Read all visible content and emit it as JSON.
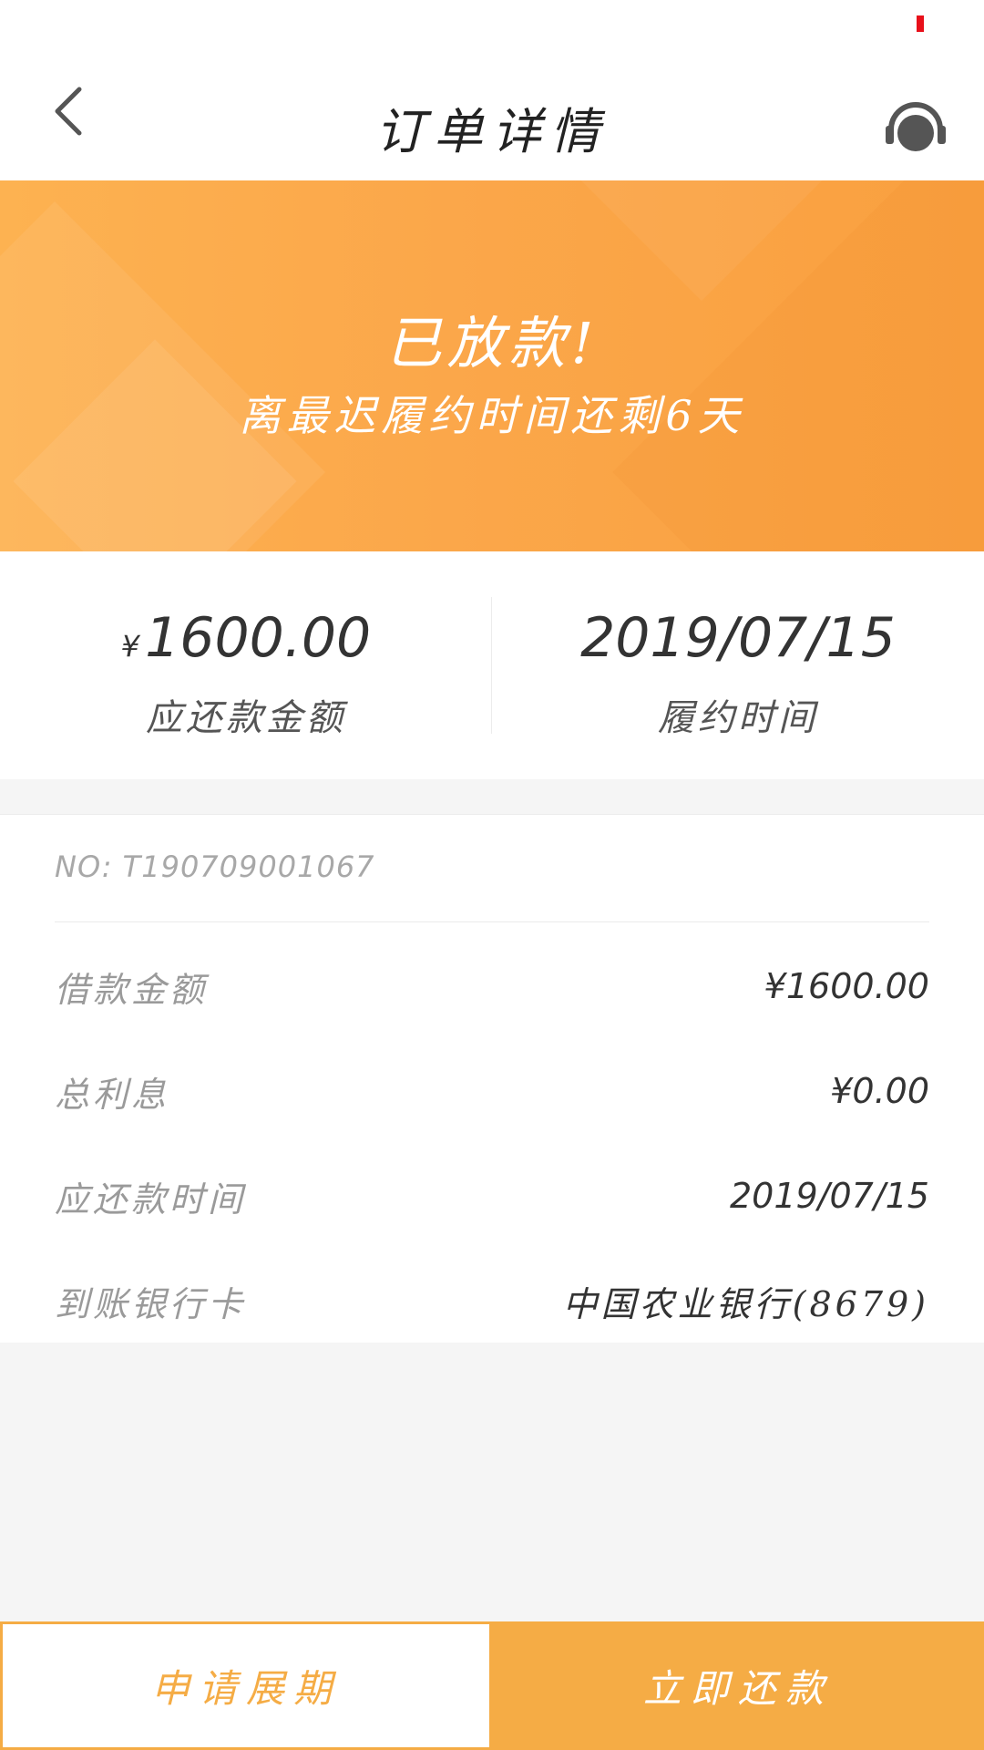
{
  "status_bar": {
    "indicator_color": "#e8101a"
  },
  "nav": {
    "title": "订单详情",
    "back_icon": "chevron-left-icon",
    "service_icon": "headset-icon"
  },
  "banner": {
    "title": "已放款!",
    "subtitle": "离最迟履约时间还剩6天",
    "color": "#f9a03f"
  },
  "summary": {
    "amount": {
      "currency": "¥",
      "value": "1600.00",
      "label": "应还款金额"
    },
    "date": {
      "value": "2019/07/15",
      "label": "履约时间"
    }
  },
  "details": {
    "order_no": "NO: T190709001067",
    "rows": [
      {
        "label": "借款金额",
        "value": "¥1600.00"
      },
      {
        "label": "总利息",
        "value": "¥0.00"
      },
      {
        "label": "应还款时间",
        "value": "2019/07/15"
      },
      {
        "label": "到账银行卡",
        "value": "中国农业银行(8679)"
      }
    ]
  },
  "actions": {
    "extend_label": "申请展期",
    "repay_label": "立即还款",
    "accent_color": "#f5ac45"
  }
}
